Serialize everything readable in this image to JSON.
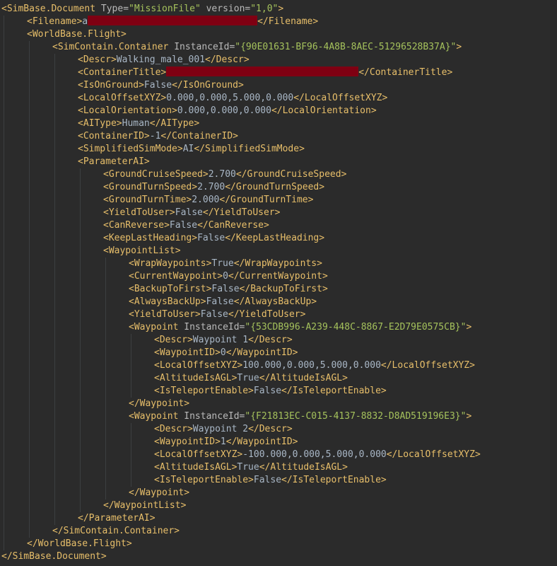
{
  "editor": {
    "lines": [
      {
        "indent": 0,
        "parts": [
          [
            "t",
            "<SimBase.Document "
          ],
          [
            "an",
            "Type="
          ],
          [
            "av",
            "\"MissionFile\""
          ],
          [
            "an",
            " version="
          ],
          [
            "av",
            "\"1,0\""
          ],
          [
            "t",
            ">"
          ]
        ]
      },
      {
        "indent": 1,
        "parts": [
          [
            "t",
            "<Filename>"
          ],
          [
            "tx",
            "a"
          ],
          [
            "redact",
            240
          ],
          [
            "t",
            "</Filename>"
          ]
        ]
      },
      {
        "indent": 1,
        "parts": [
          [
            "t",
            "<WorldBase.Flight>"
          ]
        ]
      },
      {
        "indent": 2,
        "parts": [
          [
            "t",
            "<SimContain.Container "
          ],
          [
            "an",
            "InstanceId="
          ],
          [
            "av",
            "\"{90E01631-BF96-4A8B-8AEC-51296528B37A}\""
          ],
          [
            "t",
            ">"
          ]
        ]
      },
      {
        "indent": 3,
        "parts": [
          [
            "t",
            "<Descr>"
          ],
          [
            "tx",
            "Walking_male_001"
          ],
          [
            "t",
            "</Descr>"
          ]
        ]
      },
      {
        "indent": 3,
        "parts": [
          [
            "t",
            "<ContainerTitle>"
          ],
          [
            "redact",
            272
          ],
          [
            "t",
            "</ContainerTitle>"
          ]
        ]
      },
      {
        "indent": 3,
        "parts": [
          [
            "t",
            "<IsOnGround>"
          ],
          [
            "tx",
            "False"
          ],
          [
            "t",
            "</IsOnGround>"
          ]
        ]
      },
      {
        "indent": 3,
        "parts": [
          [
            "t",
            "<LocalOffsetXYZ>"
          ],
          [
            "tx",
            "0.000,0.000,5.000,0.000"
          ],
          [
            "t",
            "</LocalOffsetXYZ>"
          ]
        ]
      },
      {
        "indent": 3,
        "parts": [
          [
            "t",
            "<LocalOrientation>"
          ],
          [
            "tx",
            "0.000,0.000,0.000"
          ],
          [
            "t",
            "</LocalOrientation>"
          ]
        ]
      },
      {
        "indent": 3,
        "parts": [
          [
            "t",
            "<AIType>"
          ],
          [
            "tx",
            "Human"
          ],
          [
            "t",
            "</AIType>"
          ]
        ]
      },
      {
        "indent": 3,
        "parts": [
          [
            "t",
            "<ContainerID>"
          ],
          [
            "tx",
            "-1"
          ],
          [
            "t",
            "</ContainerID>"
          ]
        ]
      },
      {
        "indent": 3,
        "parts": [
          [
            "t",
            "<SimplifiedSimMode>"
          ],
          [
            "tx",
            "AI"
          ],
          [
            "t",
            "</SimplifiedSimMode>"
          ]
        ]
      },
      {
        "indent": 3,
        "parts": [
          [
            "t",
            "<ParameterAI>"
          ]
        ]
      },
      {
        "indent": 4,
        "parts": [
          [
            "t",
            "<GroundCruiseSpeed>"
          ],
          [
            "tx",
            "2.700"
          ],
          [
            "t",
            "</GroundCruiseSpeed>"
          ]
        ]
      },
      {
        "indent": 4,
        "parts": [
          [
            "t",
            "<GroundTurnSpeed>"
          ],
          [
            "tx",
            "2.700"
          ],
          [
            "t",
            "</GroundTurnSpeed>"
          ]
        ]
      },
      {
        "indent": 4,
        "parts": [
          [
            "t",
            "<GroundTurnTime>"
          ],
          [
            "tx",
            "2.000"
          ],
          [
            "t",
            "</GroundTurnTime>"
          ]
        ]
      },
      {
        "indent": 4,
        "parts": [
          [
            "t",
            "<YieldToUser>"
          ],
          [
            "tx",
            "False"
          ],
          [
            "t",
            "</YieldToUser>"
          ]
        ]
      },
      {
        "indent": 4,
        "parts": [
          [
            "t",
            "<CanReverse>"
          ],
          [
            "tx",
            "False"
          ],
          [
            "t",
            "</CanReverse>"
          ]
        ]
      },
      {
        "indent": 4,
        "parts": [
          [
            "t",
            "<KeepLastHeading>"
          ],
          [
            "tx",
            "False"
          ],
          [
            "t",
            "</KeepLastHeading>"
          ]
        ]
      },
      {
        "indent": 4,
        "parts": [
          [
            "t",
            "<WaypointList>"
          ]
        ]
      },
      {
        "indent": 5,
        "parts": [
          [
            "t",
            "<WrapWaypoints>"
          ],
          [
            "tx",
            "True"
          ],
          [
            "t",
            "</WrapWaypoints>"
          ]
        ]
      },
      {
        "indent": 5,
        "parts": [
          [
            "t",
            "<CurrentWaypoint>"
          ],
          [
            "tx",
            "0"
          ],
          [
            "t",
            "</CurrentWaypoint>"
          ]
        ]
      },
      {
        "indent": 5,
        "parts": [
          [
            "t",
            "<BackupToFirst>"
          ],
          [
            "tx",
            "False"
          ],
          [
            "t",
            "</BackupToFirst>"
          ]
        ]
      },
      {
        "indent": 5,
        "parts": [
          [
            "t",
            "<AlwaysBackUp>"
          ],
          [
            "tx",
            "False"
          ],
          [
            "t",
            "</AlwaysBackUp>"
          ]
        ]
      },
      {
        "indent": 5,
        "parts": [
          [
            "t",
            "<YieldToUser>"
          ],
          [
            "tx",
            "False"
          ],
          [
            "t",
            "</YieldToUser>"
          ]
        ]
      },
      {
        "indent": 5,
        "parts": [
          [
            "t",
            "<Waypoint "
          ],
          [
            "an",
            "InstanceId="
          ],
          [
            "av",
            "\"{53CDB996-A239-448C-8867-E2D79E0575CB}\""
          ],
          [
            "t",
            ">"
          ]
        ]
      },
      {
        "indent": 6,
        "parts": [
          [
            "t",
            "<Descr>"
          ],
          [
            "tx",
            "Waypoint 1"
          ],
          [
            "t",
            "</Descr>"
          ]
        ]
      },
      {
        "indent": 6,
        "parts": [
          [
            "t",
            "<WaypointID>"
          ],
          [
            "tx",
            "0"
          ],
          [
            "t",
            "</WaypointID>"
          ]
        ]
      },
      {
        "indent": 6,
        "parts": [
          [
            "t",
            "<LocalOffsetXYZ>"
          ],
          [
            "tx",
            "100.000,0.000,5.000,0.000"
          ],
          [
            "t",
            "</LocalOffsetXYZ>"
          ]
        ]
      },
      {
        "indent": 6,
        "parts": [
          [
            "t",
            "<AltitudeIsAGL>"
          ],
          [
            "tx",
            "True"
          ],
          [
            "t",
            "</AltitudeIsAGL>"
          ]
        ]
      },
      {
        "indent": 6,
        "parts": [
          [
            "t",
            "<IsTeleportEnable>"
          ],
          [
            "tx",
            "False"
          ],
          [
            "t",
            "</IsTeleportEnable>"
          ]
        ]
      },
      {
        "indent": 5,
        "parts": [
          [
            "t",
            "</Waypoint>"
          ]
        ]
      },
      {
        "indent": 5,
        "parts": [
          [
            "t",
            "<Waypoint "
          ],
          [
            "an",
            "InstanceId="
          ],
          [
            "av",
            "\"{F21813EC-C015-4137-8832-D8AD519196E3}\""
          ],
          [
            "t",
            ">"
          ]
        ]
      },
      {
        "indent": 6,
        "parts": [
          [
            "t",
            "<Descr>"
          ],
          [
            "tx",
            "Waypoint 2"
          ],
          [
            "t",
            "</Descr>"
          ]
        ]
      },
      {
        "indent": 6,
        "parts": [
          [
            "t",
            "<WaypointID>"
          ],
          [
            "tx",
            "1"
          ],
          [
            "t",
            "</WaypointID>"
          ]
        ]
      },
      {
        "indent": 6,
        "parts": [
          [
            "t",
            "<LocalOffsetXYZ>"
          ],
          [
            "tx",
            "-100.000,0.000,5.000,0.000"
          ],
          [
            "t",
            "</LocalOffsetXYZ>"
          ]
        ]
      },
      {
        "indent": 6,
        "parts": [
          [
            "t",
            "<AltitudeIsAGL>"
          ],
          [
            "tx",
            "True"
          ],
          [
            "t",
            "</AltitudeIsAGL>"
          ]
        ]
      },
      {
        "indent": 6,
        "parts": [
          [
            "t",
            "<IsTeleportEnable>"
          ],
          [
            "tx",
            "False"
          ],
          [
            "t",
            "</IsTeleportEnable>"
          ]
        ]
      },
      {
        "indent": 5,
        "parts": [
          [
            "t",
            "</Waypoint>"
          ]
        ]
      },
      {
        "indent": 4,
        "parts": [
          [
            "t",
            "</WaypointList>"
          ]
        ]
      },
      {
        "indent": 3,
        "parts": [
          [
            "t",
            "</ParameterAI>"
          ]
        ]
      },
      {
        "indent": 2,
        "parts": [
          [
            "t",
            "</SimContain.Container>"
          ]
        ]
      },
      {
        "indent": 1,
        "parts": [
          [
            "t",
            "</WorldBase.Flight>"
          ]
        ]
      },
      {
        "indent": 0,
        "parts": [
          [
            "t",
            "</SimBase.Document>"
          ]
        ]
      }
    ]
  }
}
